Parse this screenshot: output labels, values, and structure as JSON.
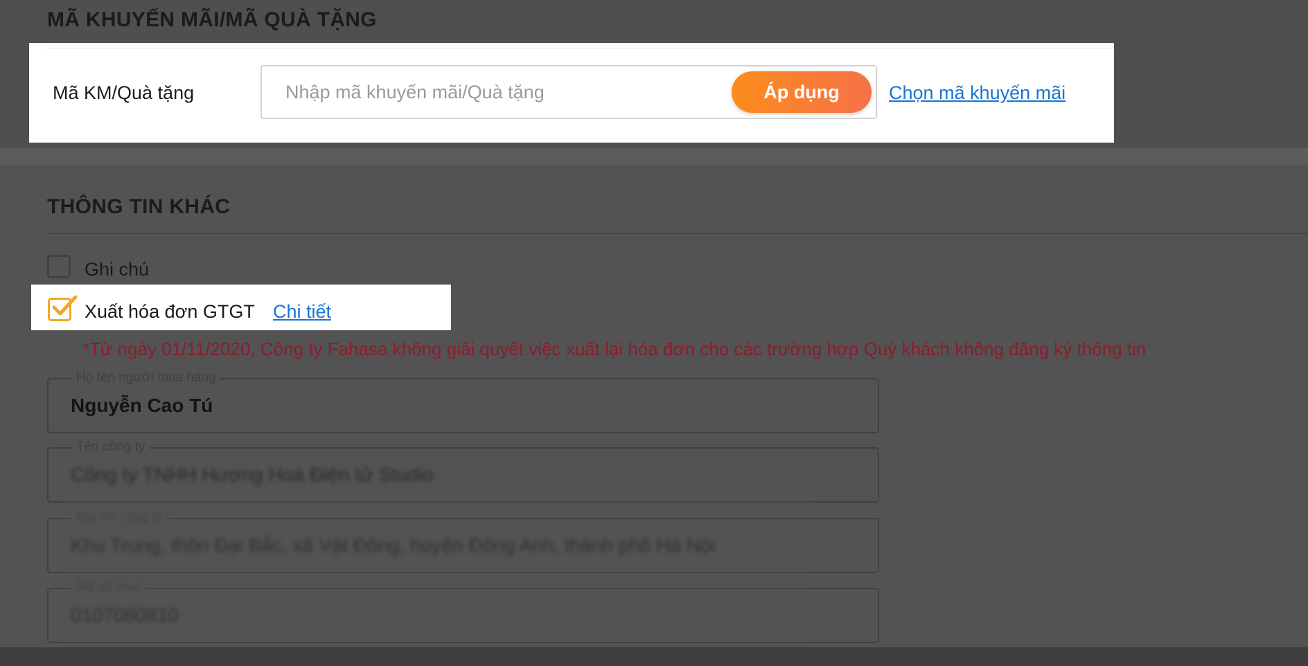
{
  "promo_section": {
    "title": "MÃ KHUYẾN MÃI/MÃ QUÀ TẶNG",
    "label": "Mã KM/Quà tặng",
    "input_placeholder": "Nhập mã khuyến mãi/Quà tặng",
    "apply_button": "Áp dụng",
    "choose_link": "Chọn mã khuyến mãi"
  },
  "other_info": {
    "title": "THÔNG TIN KHÁC",
    "note_checkbox": {
      "label": "Ghi chú",
      "checked": false
    },
    "vat_checkbox": {
      "label": "Xuất hóa đơn GTGT",
      "checked": true,
      "detail_link": "Chi tiết"
    },
    "notice": "*Từ ngày 01/11/2020, Công ty Fahasa không giải quyết việc xuất lại hóa đơn cho các trường hợp Quý khách không đăng ký thông tin",
    "fields": [
      {
        "label": "Họ tên người mua hàng",
        "value": "Nguyễn Cao Tú"
      },
      {
        "label": "Tên công ty",
        "value": "Công ty TNHH Hương Hoà Điện tử Studio"
      },
      {
        "label": "Địa chỉ công ty",
        "value": "Khu Trung, thôn Đại Bắc, xã Vật Đông, huyện Đông Anh, thành phố Hà Nội"
      },
      {
        "label": "Mã số thuế",
        "value": "0107080810"
      }
    ]
  },
  "colors": {
    "accent_orange": "#fb8c1c",
    "link_blue": "#1875d1",
    "notice_red": "#8c1c2e"
  }
}
